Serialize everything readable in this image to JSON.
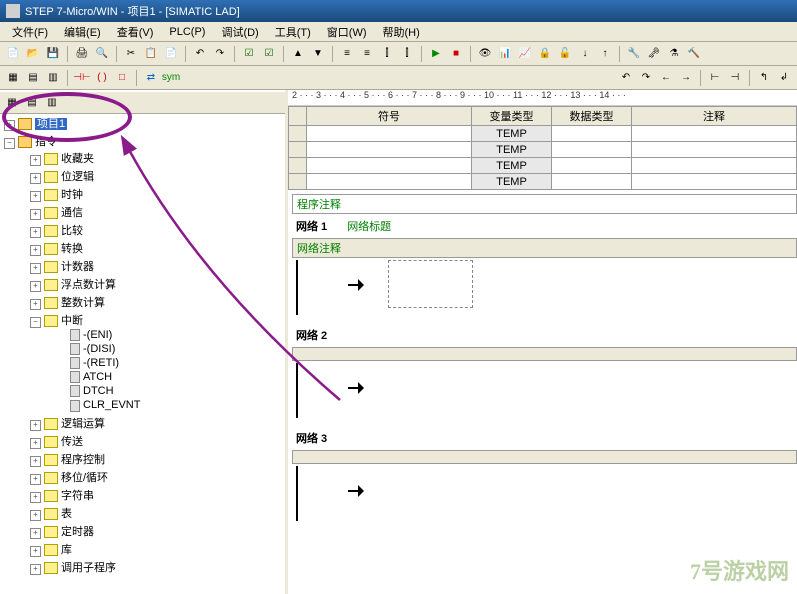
{
  "title": "STEP 7-Micro/WIN - 项目1 - [SIMATIC LAD]",
  "menu": [
    "文件(F)",
    "编辑(E)",
    "查看(V)",
    "PLC(P)",
    "调试(D)",
    "工具(T)",
    "窗口(W)",
    "帮助(H)"
  ],
  "tree": {
    "root": "项目1",
    "instr": "指令",
    "items": [
      "收藏夹",
      "位逻辑",
      "时钟",
      "通信",
      "比较",
      "转换",
      "计数器",
      "浮点数计算",
      "整数计算"
    ],
    "interrupt": {
      "label": "中断",
      "children": [
        "-(ENI)",
        "-(DISI)",
        "-(RETI)",
        "ATCH",
        "DTCH",
        "CLR_EVNT"
      ]
    },
    "items2": [
      "逻辑运算",
      "传送",
      "程序控制",
      "移位/循环",
      "字符串",
      "表",
      "定时器",
      "库",
      "调用子程序"
    ]
  },
  "ruler": "2 · · · 3 · · · 4 · · · 5 · · · 6 · · · 7 · · · 8 · · · 9 · · · 10 · · · 11 · · · 12 · · · 13 · · · 14 · · ·",
  "symtable": {
    "headers": [
      "",
      "符号",
      "变量类型",
      "数据类型",
      "注释"
    ],
    "vartype": "TEMP"
  },
  "ladder": {
    "progcomment": "程序注释",
    "nets": [
      {
        "label": "网络 1",
        "title": "网络标题",
        "comment": "网络注释",
        "dashed": true
      },
      {
        "label": "网络 2"
      },
      {
        "label": "网络 3"
      }
    ]
  },
  "watermark": "7号游戏网"
}
